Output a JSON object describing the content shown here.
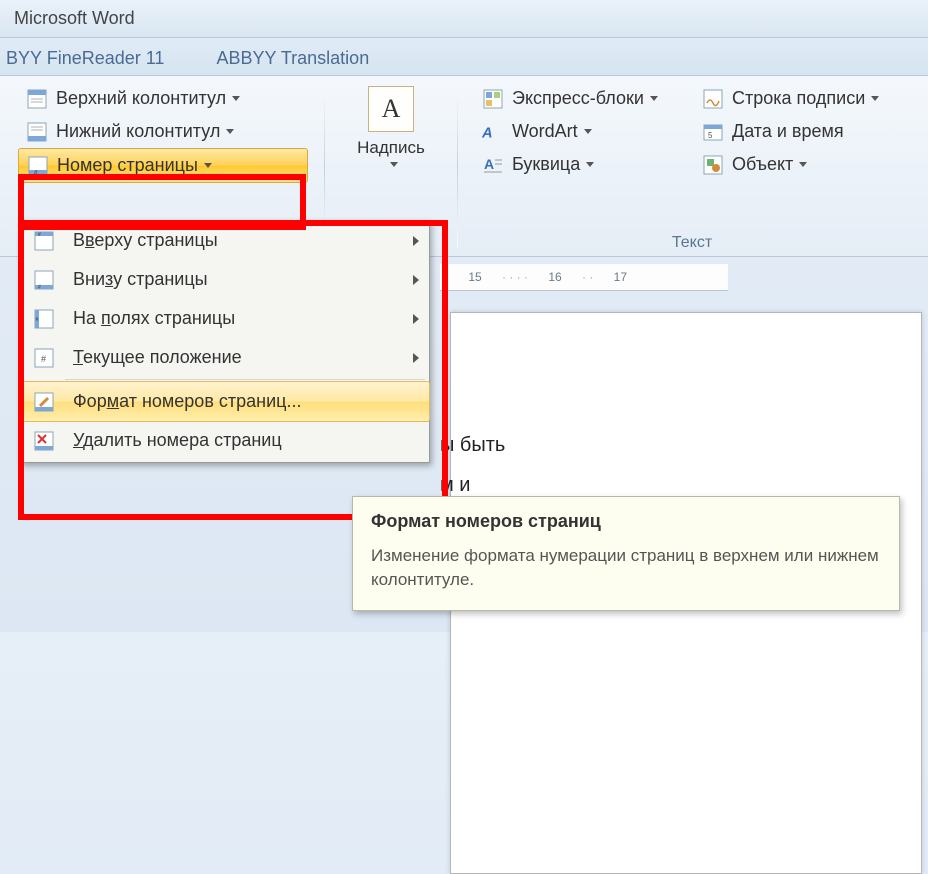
{
  "window": {
    "title": "Microsoft Word"
  },
  "tabs": {
    "finereader": "BYY FineReader 11",
    "translation": "ABBYY Translation"
  },
  "ribbon": {
    "header_top": "Верхний колонтитул",
    "header_bottom": "Нижний колонтитул",
    "page_number": "Номер страницы",
    "textbox": "Надпись",
    "quick_parts": "Экспресс-блоки",
    "wordart": "WordArt",
    "dropcap": "Буквица",
    "signature": "Строка подписи",
    "datetime": "Дата и время",
    "object": "Объект",
    "group_text": "Текст"
  },
  "menu": {
    "top_pre": "В",
    "top_u": "в",
    "top_post": "ерху страницы",
    "bottom_pre": "Вни",
    "bottom_u": "з",
    "bottom_post": "у страницы",
    "margins_pre": "На ",
    "margins_u": "п",
    "margins_post": "олях страницы",
    "current_pre": "",
    "current_u": "Т",
    "current_post": "екущее положение",
    "format_pre": "Фор",
    "format_u": "м",
    "format_post": "ат номеров страниц...",
    "remove_pre": "",
    "remove_u": "У",
    "remove_post": "далить номера страниц"
  },
  "ruler": {
    "m15": "15",
    "m16": "16",
    "m17": "17"
  },
  "peek": {
    "line1": "ы быть",
    "line2": "м и"
  },
  "tooltip": {
    "title": "Формат номеров страниц",
    "body": "Изменение формата нумерации страниц в верхнем или нижнем колонтитуле."
  }
}
